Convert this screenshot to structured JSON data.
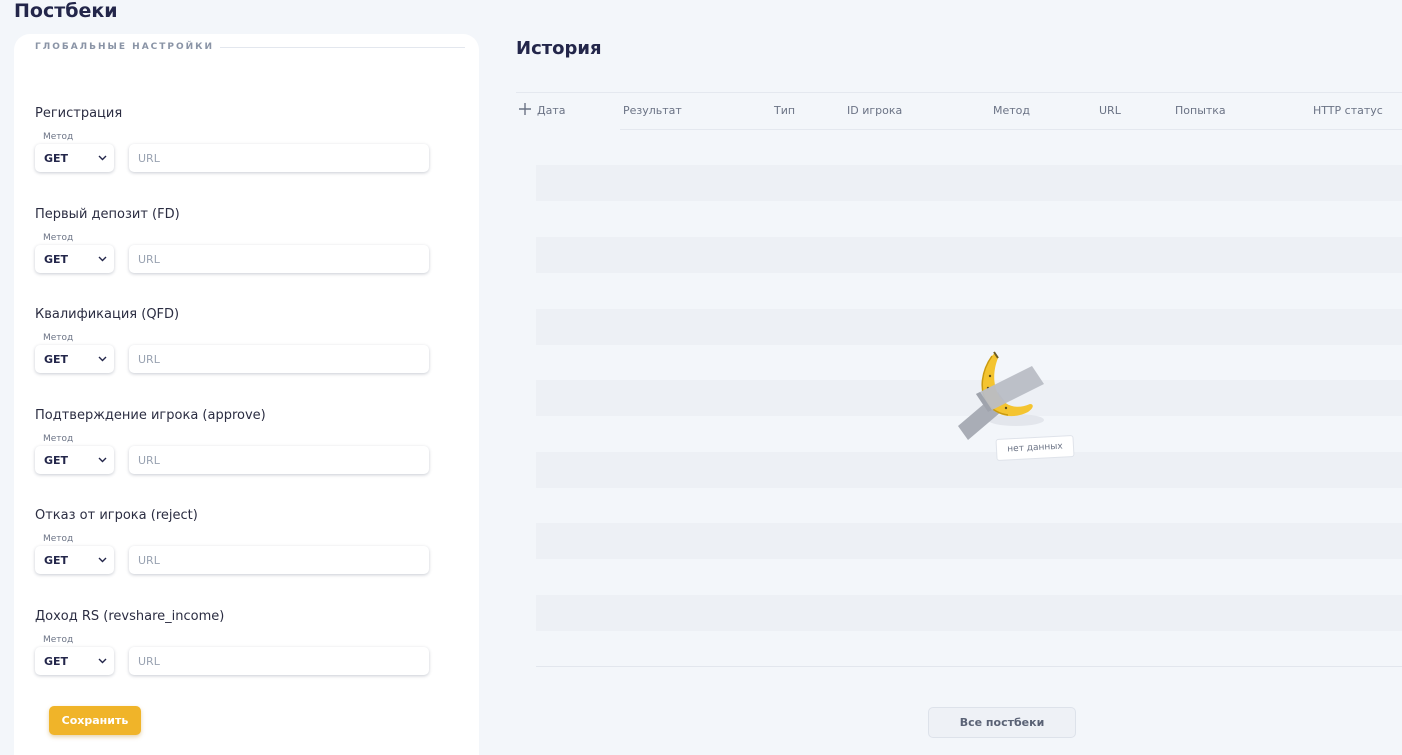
{
  "page": {
    "title": "Постбеки"
  },
  "settings": {
    "section_title": "ГЛОБАЛЬНЫЕ НАСТРОЙКИ",
    "method_caption": "Метод",
    "url_placeholder": "URL",
    "events": [
      {
        "label": "Регистрация",
        "method": "GET",
        "url": ""
      },
      {
        "label": "Первый депозит (FD)",
        "method": "GET",
        "url": ""
      },
      {
        "label": "Квалификация (QFD)",
        "method": "GET",
        "url": ""
      },
      {
        "label": "Подтверждение игрока (approve)",
        "method": "GET",
        "url": ""
      },
      {
        "label": "Отказ от игрока (reject)",
        "method": "GET",
        "url": ""
      },
      {
        "label": "Доход RS (revshare_income)",
        "method": "GET",
        "url": ""
      }
    ],
    "save_label": "Сохранить"
  },
  "history": {
    "title": "История",
    "columns": [
      "Дата",
      "Результат",
      "Тип",
      "ID игрока",
      "Метод",
      "URL",
      "Попытка",
      "HTTP статус"
    ],
    "rows": [],
    "empty_text": "нет данных",
    "all_button_label": "Все постбеки"
  },
  "colors": {
    "accent": "#f0b429",
    "title": "#23264a",
    "background": "#f3f6fa",
    "card": "#ffffff",
    "stripe": "#edf0f5"
  }
}
